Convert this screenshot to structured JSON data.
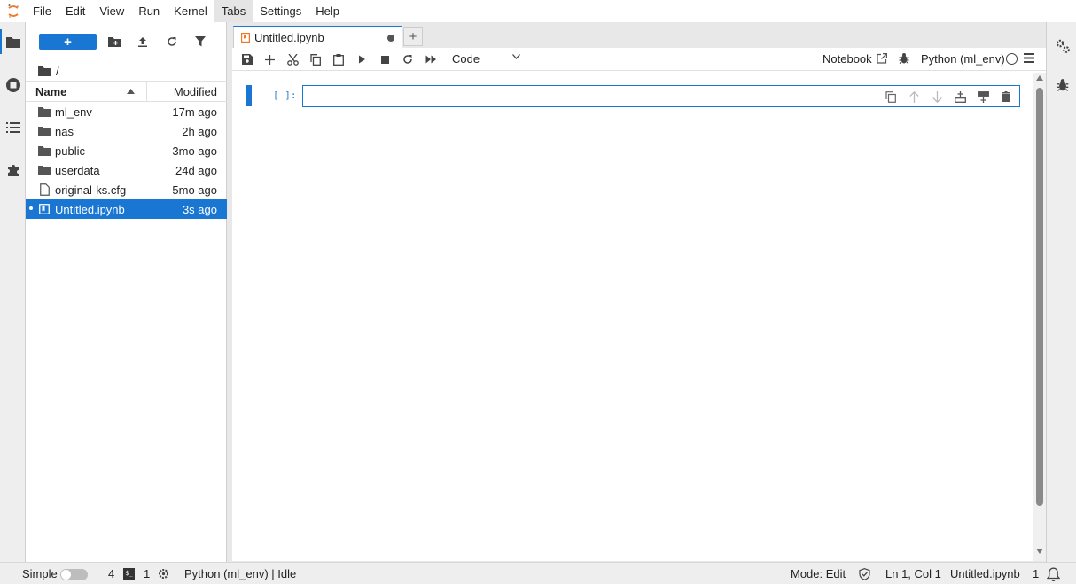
{
  "menubar": {
    "items": [
      "File",
      "Edit",
      "View",
      "Run",
      "Kernel",
      "Tabs",
      "Settings",
      "Help"
    ],
    "active_index": 5
  },
  "filebrowser": {
    "new_label": "+",
    "breadcrumb": "/",
    "columns": {
      "name": "Name",
      "modified": "Modified"
    },
    "files": [
      {
        "name": "ml_env",
        "modified": "17m ago",
        "type": "folder-icon"
      },
      {
        "name": "nas",
        "modified": "2h ago",
        "type": "folder-icon"
      },
      {
        "name": "public",
        "modified": "3mo ago",
        "type": "folder-icon"
      },
      {
        "name": "userdata",
        "modified": "24d ago",
        "type": "folder-icon"
      },
      {
        "name": "original-ks.cfg",
        "modified": "5mo ago",
        "type": "file-icon"
      },
      {
        "name": "Untitled.ipynb",
        "modified": "3s ago",
        "type": "notebook-icon",
        "selected": true,
        "running": true
      }
    ]
  },
  "tabs": {
    "active_label": "Untitled.ipynb",
    "add_label": "+"
  },
  "notebook_toolbar": {
    "cell_type": "Code",
    "notebook_link": "Notebook",
    "kernel_name": "Python (ml_env)"
  },
  "cell": {
    "prompt": "[ ]:",
    "content": ""
  },
  "statusbar": {
    "simple_label": "Simple",
    "terminals_count": "4",
    "terminal_icon_text": "$_",
    "kernels_count": "1",
    "kernel_status": "Python (ml_env) | Idle",
    "mode": "Mode: Edit",
    "cursor": "Ln 1, Col 1",
    "filename": "Untitled.ipynb",
    "notifications": "1"
  },
  "colors": {
    "accent": "#1976d2",
    "logo": "#f37726"
  }
}
